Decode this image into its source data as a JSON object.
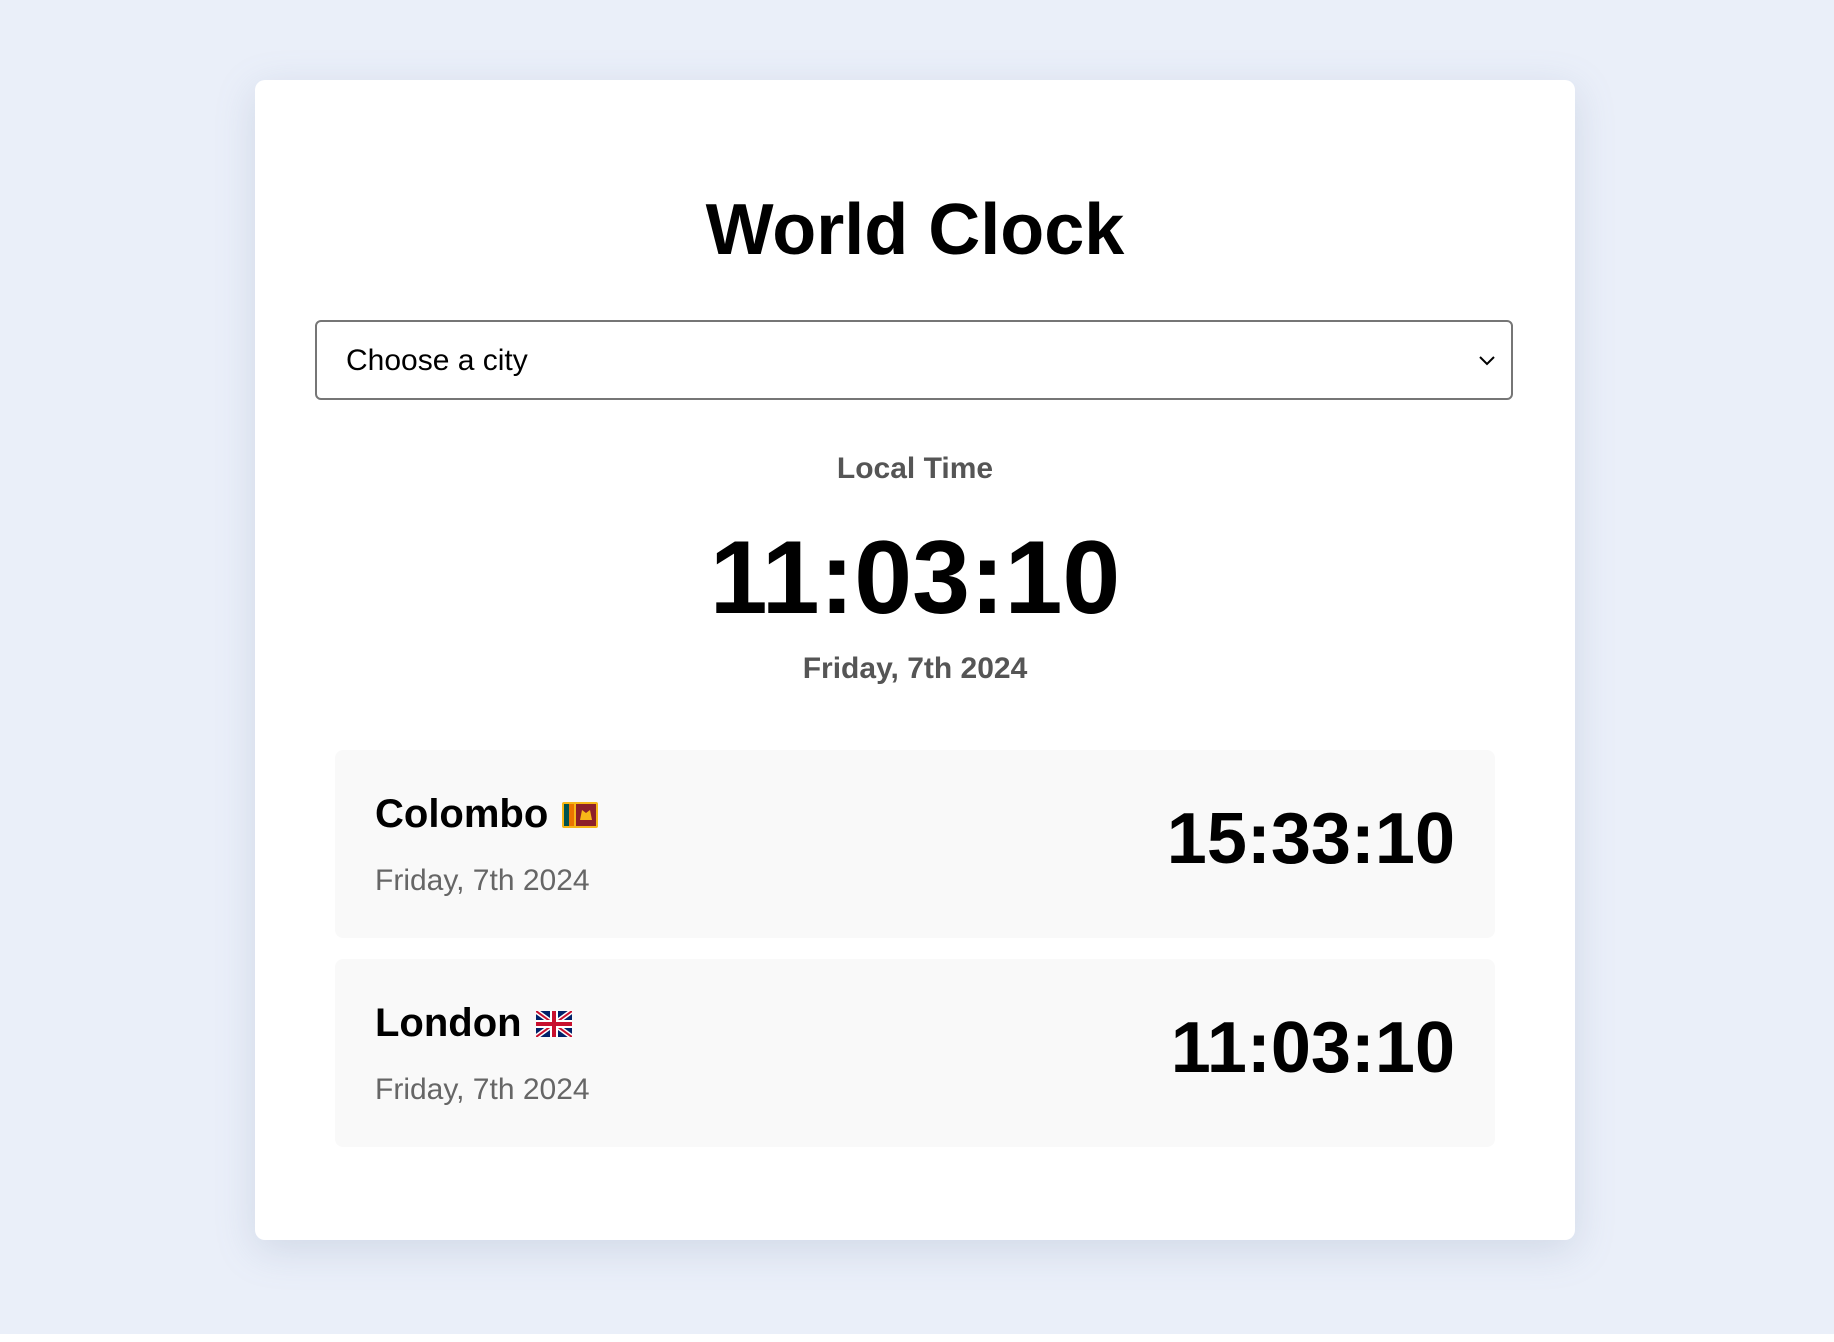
{
  "app": {
    "title": "World Clock"
  },
  "city_select": {
    "selected": "Choose a city",
    "icon": "chevron-down-icon"
  },
  "local": {
    "label": "Local Time",
    "time": "11:03:10",
    "date": "Friday, 7th 2024"
  },
  "cities": [
    {
      "name": "Colombo",
      "flag": "sri-lanka-flag-icon",
      "date": "Friday, 7th 2024",
      "time": "15:33:10"
    },
    {
      "name": "London",
      "flag": "uk-flag-icon",
      "date": "Friday, 7th 2024",
      "time": "11:03:10"
    }
  ],
  "colors": {
    "page_background": "#eaeff9",
    "card_background": "#ffffff",
    "row_background": "#f9f9f9",
    "muted_text": "#555555"
  }
}
